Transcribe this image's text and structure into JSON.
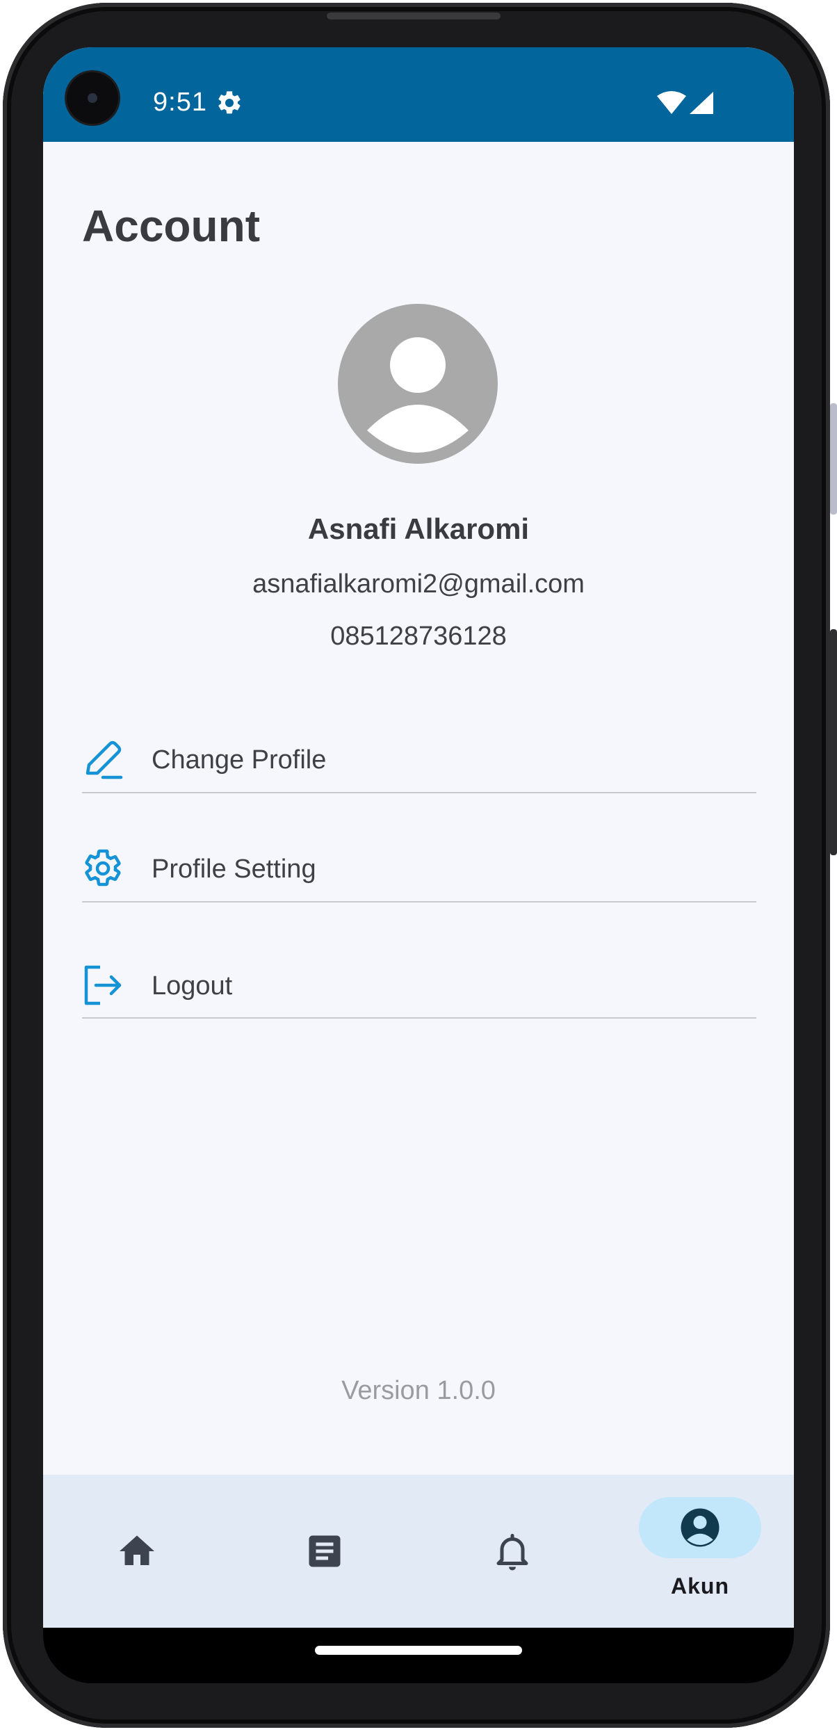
{
  "status_bar": {
    "time": "9:51",
    "icons": [
      "settings-icon",
      "wifi-icon",
      "cell-signal-icon"
    ]
  },
  "page": {
    "title": "Account"
  },
  "profile": {
    "avatar_icon": "account-circle-icon",
    "name": "Asnafi Alkaromi",
    "email": "asnafialkaromi2@gmail.com",
    "phone": "085128736128"
  },
  "menu": {
    "items": [
      {
        "label": "Change Profile",
        "icon": "edit-pencil-icon"
      },
      {
        "label": "Profile Setting",
        "icon": "gear-icon"
      },
      {
        "label": "Logout",
        "icon": "logout-icon"
      }
    ]
  },
  "footer": {
    "version": "Version 1.0.0"
  },
  "bottom_nav": {
    "items": [
      {
        "icon": "home-icon",
        "label": ""
      },
      {
        "icon": "article-icon",
        "label": ""
      },
      {
        "icon": "bell-icon",
        "label": ""
      },
      {
        "icon": "account-icon",
        "label": "Akun",
        "active": true
      }
    ]
  },
  "colors": {
    "status_bar": "#02659c",
    "accent_icon": "#1693d6",
    "background": "#f6f7fc",
    "nav_background": "#e2eaf5",
    "nav_active_pill": "#c2e7fb",
    "avatar_gray": "#a9a9a9"
  }
}
